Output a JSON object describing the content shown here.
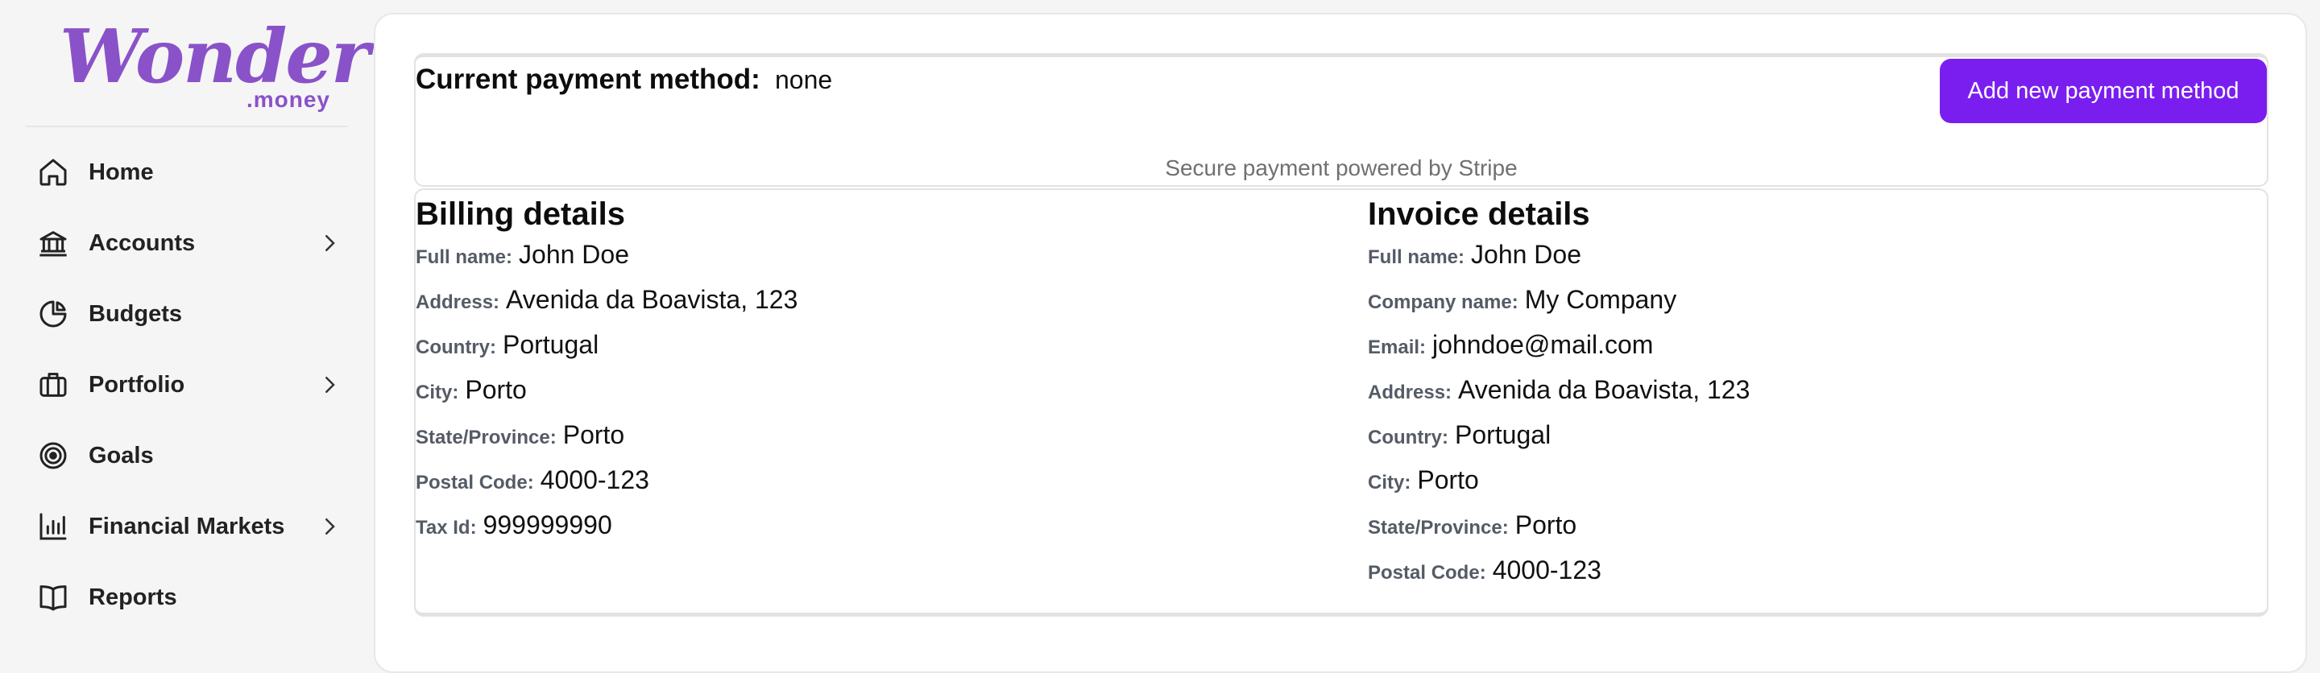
{
  "logo": {
    "word": "Wonder",
    "sub": ".money"
  },
  "nav": [
    {
      "label": "Home",
      "icon": "home-icon",
      "chevron": false
    },
    {
      "label": "Accounts",
      "icon": "bank-icon",
      "chevron": true
    },
    {
      "label": "Budgets",
      "icon": "pie-chart-icon",
      "chevron": false
    },
    {
      "label": "Portfolio",
      "icon": "briefcase-icon",
      "chevron": true
    },
    {
      "label": "Goals",
      "icon": "target-icon",
      "chevron": false
    },
    {
      "label": "Financial Markets",
      "icon": "bar-chart-icon",
      "chevron": true
    },
    {
      "label": "Reports",
      "icon": "book-icon",
      "chevron": false
    }
  ],
  "payment": {
    "title": "Current payment method:",
    "value": "none",
    "add_button": "Add new payment method",
    "note": "Secure payment powered by Stripe"
  },
  "billing": {
    "title": "Billing details",
    "fields": [
      {
        "label": "Full name:",
        "value": "John Doe"
      },
      {
        "label": "Address:",
        "value": "Avenida da Boavista, 123"
      },
      {
        "label": "Country:",
        "value": "Portugal"
      },
      {
        "label": "City:",
        "value": "Porto"
      },
      {
        "label": "State/Province:",
        "value": "Porto"
      },
      {
        "label": "Postal Code:",
        "value": "4000-123"
      },
      {
        "label": "Tax Id:",
        "value": "999999990"
      }
    ]
  },
  "invoice": {
    "title": "Invoice details",
    "fields": [
      {
        "label": "Full name:",
        "value": "John Doe"
      },
      {
        "label": "Company name:",
        "value": "My Company"
      },
      {
        "label": "Email:",
        "value": "johndoe@mail.com"
      },
      {
        "label": "Address:",
        "value": "Avenida da Boavista, 123"
      },
      {
        "label": "Country:",
        "value": "Portugal"
      },
      {
        "label": "City:",
        "value": "Porto"
      },
      {
        "label": "State/Province:",
        "value": "Porto"
      },
      {
        "label": "Postal Code:",
        "value": "4000-123"
      }
    ]
  },
  "colors": {
    "brand": "#8a52c8",
    "accent": "#7a1ef0"
  }
}
